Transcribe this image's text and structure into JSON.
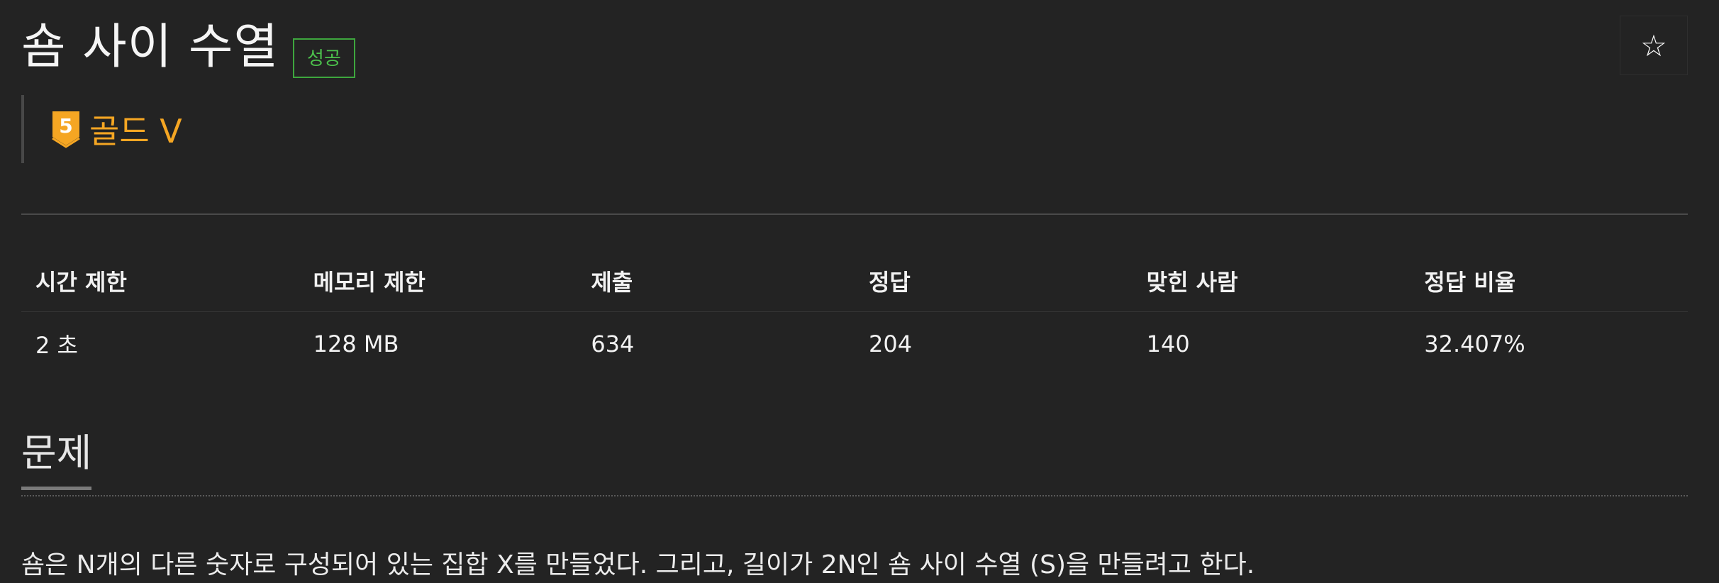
{
  "problem": {
    "title": "숌 사이 수열",
    "result_badge": "성공",
    "star_icon": "☆"
  },
  "tier": {
    "level": "5",
    "label": "골드 V",
    "icon": "gold-tier-icon",
    "color": "#f5a623"
  },
  "stats": {
    "headers": [
      "시간 제한",
      "메모리 제한",
      "제출",
      "정답",
      "맞힌 사람",
      "정답 비율"
    ],
    "values": [
      "2 초",
      "128 MB",
      "634",
      "204",
      "140",
      "32.407%"
    ]
  },
  "sections": {
    "problem_title": "문제",
    "problem_text": "숌은 N개의 다른 숫자로 구성되어 있는 집합 X를 만들었다. 그리고, 길이가 2N인 숌 사이 수열 (S)을 만들려고 한다."
  },
  "colors": {
    "background": "#232323",
    "success": "#4cc04c",
    "tier_gold": "#f5a623"
  }
}
